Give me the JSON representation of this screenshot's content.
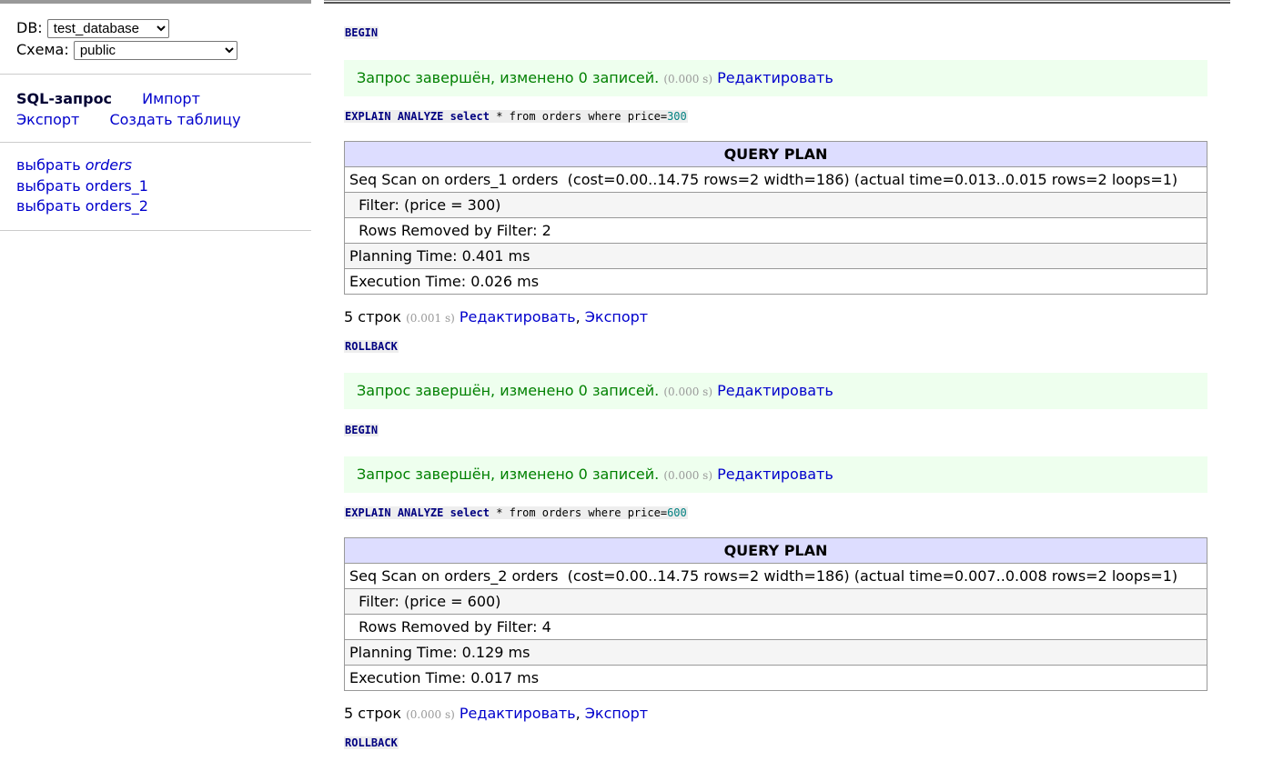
{
  "sidebar": {
    "db_label": "DB:",
    "db_value": "test_database",
    "schema_label": "Схема:",
    "schema_value": "public",
    "links": {
      "sql": "SQL-запрос",
      "import": "Импорт",
      "export": "Экспорт",
      "create_table": "Создать таблицу"
    },
    "tables": [
      {
        "action": "выбрать",
        "name": "orders"
      },
      {
        "action": "выбрать",
        "name": "orders_1"
      },
      {
        "action": "выбрать",
        "name": "orders_2"
      }
    ]
  },
  "content": {
    "begin1": "BEGIN",
    "msg1": {
      "text": "Запрос завершён, изменено 0 записей.",
      "time": "(0.000 s)",
      "edit": "Редактировать"
    },
    "query1": {
      "kw1": "EXPLAIN",
      "kw2": "ANALYZE",
      "kw3": "select",
      "rest": " * from orders where price=",
      "num": "300"
    },
    "plan1": {
      "header": "QUERY PLAN",
      "rows": [
        "Seq Scan on orders_1 orders  (cost=0.00..14.75 rows=2 width=186) (actual time=0.013..0.015 rows=2 loops=1)",
        "  Filter: (price = 300)",
        "  Rows Removed by Filter: 2",
        "Planning Time: 0.401 ms",
        "Execution Time: 0.026 ms"
      ]
    },
    "result1": {
      "count": "5 строк",
      "time": "(0.001 s)",
      "edit": "Редактировать",
      "sep": ",",
      "export": "Экспорт"
    },
    "rollback1": "ROLLBACK",
    "msg2": {
      "text": "Запрос завершён, изменено 0 записей.",
      "time": "(0.000 s)",
      "edit": "Редактировать"
    },
    "begin2": "BEGIN",
    "msg3": {
      "text": "Запрос завершён, изменено 0 записей.",
      "time": "(0.000 s)",
      "edit": "Редактировать"
    },
    "query2": {
      "kw1": "EXPLAIN",
      "kw2": "ANALYZE",
      "kw3": "select",
      "rest": " * from orders where price=",
      "num": "600"
    },
    "plan2": {
      "header": "QUERY PLAN",
      "rows": [
        "Seq Scan on orders_2 orders  (cost=0.00..14.75 rows=2 width=186) (actual time=0.007..0.008 rows=2 loops=1)",
        "  Filter: (price = 600)",
        "  Rows Removed by Filter: 4",
        "Planning Time: 0.129 ms",
        "Execution Time: 0.017 ms"
      ]
    },
    "result2": {
      "count": "5 строк",
      "time": "(0.000 s)",
      "edit": "Редактировать",
      "sep": ",",
      "export": "Экспорт"
    },
    "rollback2": "ROLLBACK"
  }
}
